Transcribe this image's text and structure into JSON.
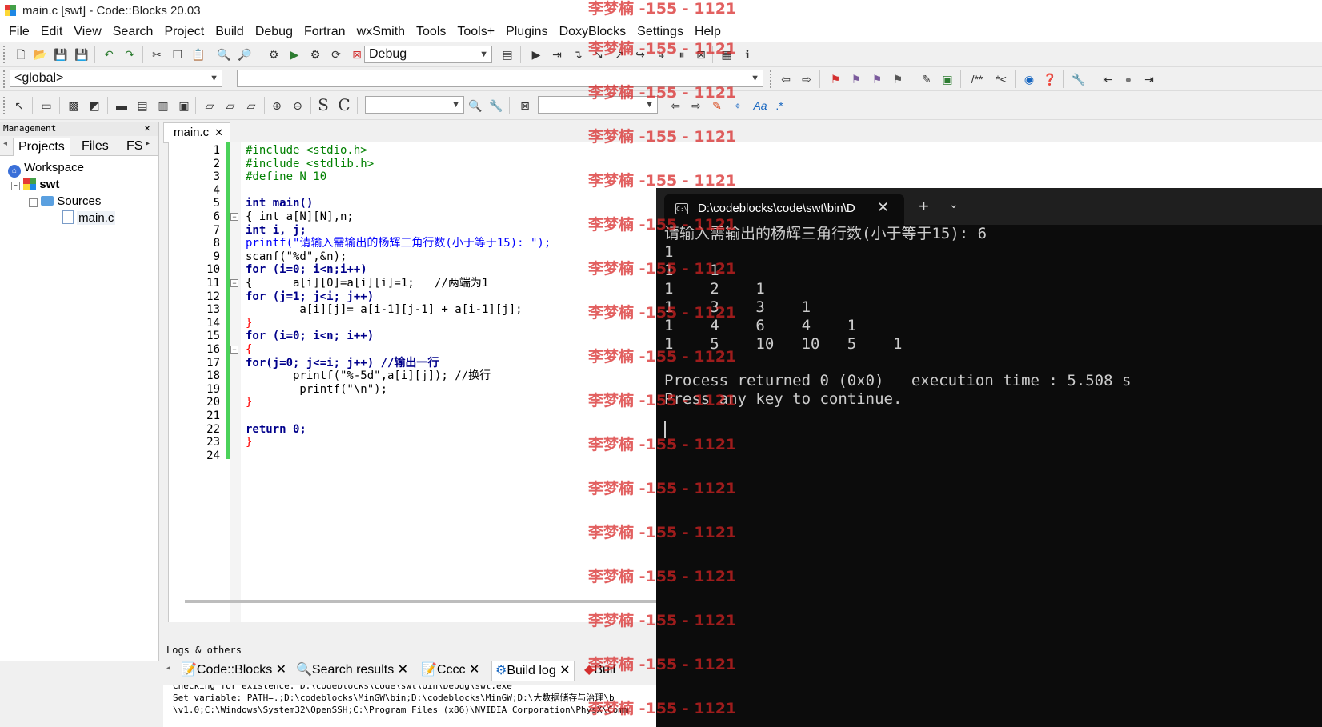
{
  "window": {
    "title": "main.c [swt] - Code::Blocks 20.03"
  },
  "menu": [
    "File",
    "Edit",
    "View",
    "Search",
    "Project",
    "Build",
    "Debug",
    "Fortran",
    "wxSmith",
    "Tools",
    "Tools+",
    "Plugins",
    "DoxyBlocks",
    "Settings",
    "Help"
  ],
  "toolbar": {
    "build_target": "Debug",
    "scope": "<global>",
    "function": "",
    "doxy_comment1": "/**",
    "doxy_comment2": "*<",
    "search_combo": "",
    "regex_combo": "",
    "s_label": "S",
    "c_label": "C",
    "aa_label": "Aa",
    "regex_label": ".*"
  },
  "management": {
    "header": "Management",
    "tabs": [
      "Projects",
      "Files",
      "FS"
    ],
    "tree": {
      "workspace": "Workspace",
      "project": "swt",
      "folder": "Sources",
      "file": "main.c"
    }
  },
  "editor": {
    "tab": "main.c",
    "line_numbers": [
      "1",
      "2",
      "3",
      "4",
      "5",
      "6",
      "7",
      "8",
      "9",
      "10",
      "11",
      "12",
      "13",
      "14",
      "15",
      "16",
      "17",
      "18",
      "19",
      "20",
      "21",
      "22",
      "23",
      "24"
    ],
    "lines": [
      "#include <stdio.h>",
      "#include <stdlib.h>",
      "#define N 10",
      "",
      "int main()",
      "{ int a[N][N],n;",
      "int i, j;",
      "printf(\"请输入需输出的杨辉三角行数(小于等于15): \");",
      "scanf(\"%d\",&n);",
      "for (i=0; i<n;i++)",
      "{      a[i][0]=a[i][i]=1;   //两端为1",
      "for (j=1; j<i; j++)",
      "        a[i][j]= a[i-1][j-1] + a[i-1][j];",
      "}",
      "for (i=0; i<n; i++)",
      "{",
      "for(j=0; j<=i; j++) //输出一行",
      "       printf(\"%-5d\",a[i][j]); //换行",
      "        printf(\"\\n\");",
      "}",
      "",
      "return 0;",
      "}",
      ""
    ]
  },
  "logs": {
    "header": "Logs & others",
    "tabs": [
      "Code::Blocks",
      "Search results",
      "Cccc",
      "Build log",
      "Buil"
    ],
    "lines": [
      "Checking for existence: D:\\codeblocks\\code\\swt\\bin\\Debug\\swt.exe",
      "Set variable: PATH=.;D:\\codeblocks\\MinGW\\bin;D:\\codeblocks\\MinGW;D:\\大数据储存与治理\\b",
      "\\v1.0;C:\\Windows\\System32\\OpenSSH;C:\\Program Files (x86)\\NVIDIA Corporation\\PhysX\\Comm"
    ]
  },
  "terminal": {
    "tab_title": "D:\\codeblocks\\code\\swt\\bin\\D",
    "lines": [
      "请输入需输出的杨辉三角行数(小于等于15): 6",
      "1",
      "1    1",
      "1    2    1",
      "1    3    3    1",
      "1    4    6    4    1",
      "1    5    10   10   5    1",
      "",
      "Process returned 0 (0x0)   execution time : 5.508 s",
      "Press any key to continue."
    ]
  },
  "watermark": "李梦楠 -155 - 1121"
}
